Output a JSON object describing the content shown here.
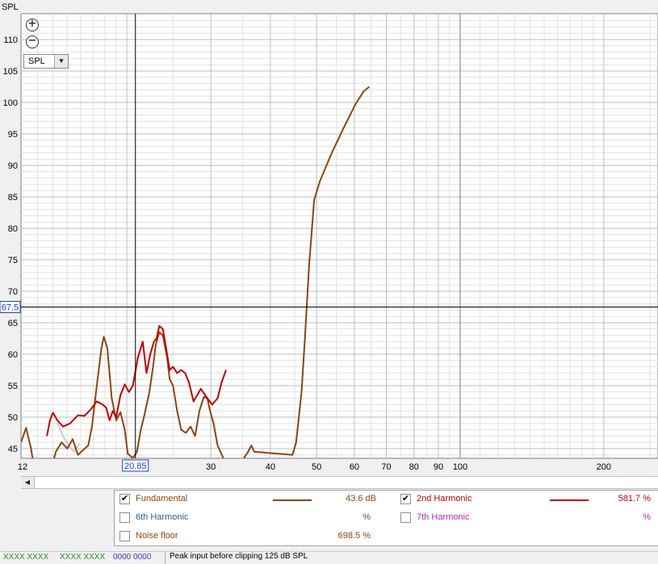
{
  "chart_data": {
    "type": "line",
    "ylabel": "SPL",
    "xscale": "log",
    "xlim": [
      12,
      300
    ],
    "ylim": [
      43,
      115
    ],
    "grid": true,
    "x_tick_labels": [
      12,
      30,
      40,
      50,
      60,
      70,
      80,
      90,
      100,
      200
    ],
    "y_tick_labels": [
      45,
      50,
      55,
      60,
      65,
      70,
      75,
      80,
      85,
      90,
      95,
      100,
      105,
      110
    ],
    "cursor": {
      "x": 20.85,
      "y": 67.5,
      "x_label": "20.85",
      "y_label": "67.5"
    },
    "series": [
      {
        "name": "Fundamental",
        "color": "#8b4513",
        "points": [
          [
            12.0,
            46.0
          ],
          [
            12.3,
            48.3
          ],
          [
            12.6,
            45.0
          ],
          [
            12.8,
            41.5
          ],
          [
            13.9,
            42.0
          ],
          [
            14.2,
            44.5
          ],
          [
            14.6,
            46.0
          ],
          [
            15.0,
            45.0
          ],
          [
            15.4,
            46.5
          ],
          [
            15.8,
            44.0
          ],
          [
            16.2,
            44.8
          ],
          [
            16.6,
            45.5
          ],
          [
            16.9,
            48.5
          ],
          [
            17.3,
            55.0
          ],
          [
            17.7,
            61.0
          ],
          [
            17.9,
            62.8
          ],
          [
            18.2,
            61.0
          ],
          [
            18.6,
            53.0
          ],
          [
            19.0,
            49.5
          ],
          [
            19.4,
            50.8
          ],
          [
            19.8,
            48.0
          ],
          [
            20.1,
            44.2
          ],
          [
            20.6,
            43.5
          ],
          [
            21.0,
            44.5
          ],
          [
            21.4,
            48.0
          ],
          [
            21.8,
            50.5
          ],
          [
            22.3,
            54.0
          ],
          [
            22.7,
            58.0
          ],
          [
            23.0,
            61.5
          ],
          [
            23.4,
            63.5
          ],
          [
            23.8,
            63.0
          ],
          [
            24.3,
            59.5
          ],
          [
            24.6,
            56.0
          ],
          [
            25.0,
            55.0
          ],
          [
            25.5,
            51.0
          ],
          [
            26.0,
            48.0
          ],
          [
            26.6,
            47.5
          ],
          [
            27.2,
            48.5
          ],
          [
            27.8,
            47.0
          ],
          [
            28.4,
            51.0
          ],
          [
            29.0,
            53.2
          ],
          [
            29.5,
            53.0
          ],
          [
            29.9,
            51.0
          ],
          [
            30.4,
            49.0
          ],
          [
            31.0,
            45.5
          ],
          [
            31.9,
            43.4
          ],
          [
            34.8,
            43.0
          ],
          [
            35.8,
            44.3
          ],
          [
            36.5,
            45.5
          ],
          [
            37.0,
            44.5
          ],
          [
            44.5,
            44.0
          ],
          [
            45.3,
            46.0
          ],
          [
            46.5,
            54.0
          ],
          [
            47.3,
            63.0
          ],
          [
            48.2,
            74.0
          ],
          [
            49.4,
            84.5
          ],
          [
            50.8,
            87.5
          ],
          [
            53.8,
            92.0
          ],
          [
            57.0,
            96.0
          ],
          [
            60.4,
            99.8
          ],
          [
            62.8,
            101.8
          ],
          [
            64.5,
            102.5
          ]
        ]
      },
      {
        "name": "2nd Harmonic",
        "color": "#c00000",
        "points": [
          [
            13.6,
            47.0
          ],
          [
            13.8,
            49.5
          ],
          [
            14.0,
            50.7
          ],
          [
            14.3,
            49.5
          ],
          [
            14.7,
            48.5
          ],
          [
            15.2,
            49.0
          ],
          [
            15.8,
            50.3
          ],
          [
            16.3,
            50.2
          ],
          [
            16.8,
            51.2
          ],
          [
            17.3,
            52.5
          ],
          [
            17.8,
            52.0
          ],
          [
            18.1,
            51.5
          ],
          [
            18.4,
            49.5
          ],
          [
            18.7,
            51.0
          ],
          [
            19.0,
            50.0
          ],
          [
            19.4,
            53.5
          ],
          [
            19.8,
            55.2
          ],
          [
            20.2,
            54.0
          ],
          [
            20.6,
            55.0
          ],
          [
            21.1,
            59.5
          ],
          [
            21.6,
            62.0
          ],
          [
            22.0,
            57.0
          ],
          [
            22.4,
            60.0
          ],
          [
            22.8,
            62.0
          ],
          [
            23.1,
            62.5
          ],
          [
            23.4,
            64.5
          ],
          [
            23.8,
            64.0
          ],
          [
            24.3,
            60.0
          ],
          [
            24.6,
            57.5
          ],
          [
            25.0,
            58.0
          ],
          [
            25.5,
            57.0
          ],
          [
            26.0,
            57.5
          ],
          [
            26.5,
            57.0
          ],
          [
            27.0,
            55.5
          ],
          [
            27.6,
            52.5
          ],
          [
            28.6,
            54.5
          ],
          [
            29.5,
            53.0
          ],
          [
            30.2,
            52.0
          ],
          [
            31.0,
            53.0
          ],
          [
            31.6,
            55.5
          ],
          [
            32.3,
            57.5
          ]
        ]
      }
    ],
    "noise_floor": {
      "color": "#cccccc",
      "points": [
        [
          14.3,
          49.2
        ],
        [
          14.7,
          47.0
        ],
        [
          15.1,
          45.5
        ],
        [
          15.5,
          44.5
        ],
        [
          15.9,
          45.8
        ]
      ]
    }
  },
  "toolbar": {
    "zoom_in_icon": "plus-circle-icon",
    "zoom_out_icon": "minus-circle-icon",
    "view_select": "SPL"
  },
  "legend": {
    "items": [
      {
        "label": "Fundamental",
        "checked": true,
        "value": "43.6 dB",
        "color": "#8b4513",
        "label_color": "#8b4513",
        "value_color": "#8b4513",
        "swatch": true
      },
      {
        "label": "2nd Harmonic",
        "checked": true,
        "value": "581.7 %",
        "color": "#c00000",
        "label_color": "#c00000",
        "value_color": "#c00000",
        "swatch": true
      },
      {
        "label": "6th Harmonic",
        "checked": false,
        "value": "%",
        "color": "#2e5fa0",
        "label_color": "#2e5fa0",
        "value_color": "#2e5fa0",
        "swatch": false
      },
      {
        "label": "7th Harmonic",
        "checked": false,
        "value": "%",
        "color": "#b030b0",
        "label_color": "#b030b0",
        "value_color": "#b030b0",
        "swatch": false
      },
      {
        "label": "Noise floor",
        "checked": false,
        "value": "698.5 %",
        "color": "#8b4513",
        "label_color": "#8b4513",
        "value_color": "#8b4513",
        "swatch": false
      }
    ]
  },
  "status": {
    "meter1": "XXXX XXXX",
    "meter2": "XXXX XXXX",
    "meter3": "0000 0000",
    "message": "Peak input before clipping 125 dB SPL"
  }
}
